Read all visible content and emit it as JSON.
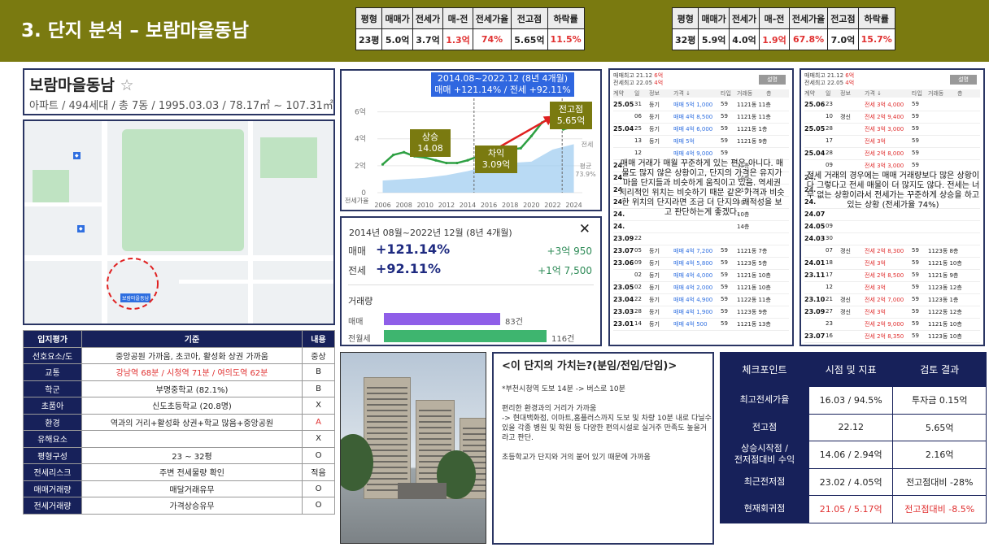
{
  "header": {
    "title": "3. 단지 분석 – 보람마을동남"
  },
  "stat_tables": [
    {
      "headers": [
        "평형",
        "매매가",
        "전세가",
        "매-전",
        "전세가율",
        "전고점",
        "하락률"
      ],
      "values": [
        "23평",
        "5.0억",
        "3.7억",
        "1.3억",
        "74%",
        "5.65억",
        "11.5%"
      ]
    },
    {
      "headers": [
        "평형",
        "매매가",
        "전세가",
        "매-전",
        "전세가율",
        "전고점",
        "하락률"
      ],
      "values": [
        "32평",
        "5.9억",
        "4.0억",
        "1.9억",
        "67.8%",
        "7.0억",
        "15.7%"
      ]
    }
  ],
  "complex": {
    "name": "보람마을동남",
    "star": "☆",
    "subtitle": "아파트 / 494세대 / 총 7동 / 1995.03.03 / 78.17㎡ ~ 107.31㎡"
  },
  "evaluation": {
    "headers": [
      "입지평가",
      "기준",
      "내용"
    ],
    "rows": [
      {
        "k": "선호요소/도",
        "c": "중앙공원 가까움, 초코아, 활성화 상권 가까움",
        "v": "중상",
        "hl": false
      },
      {
        "k": "교통",
        "c": "강남역 68분 / 시청역 71분 / 여의도역 62분",
        "v": "B",
        "hl": true
      },
      {
        "k": "학군",
        "c": "부명중학교 (82.1%)",
        "v": "B",
        "hl": false
      },
      {
        "k": "초품아",
        "c": "신도초등학교 (20.8명)",
        "v": "X",
        "hl": false
      },
      {
        "k": "환경",
        "c": "역과의 거리+활성화 상권+학교 많음+중앙공원",
        "v": "A",
        "hl": "v"
      },
      {
        "k": "유해요소",
        "c": "",
        "v": "X",
        "hl": false
      },
      {
        "k": "평형구성",
        "c": "23 ~ 32평",
        "v": "O",
        "hl": false
      },
      {
        "k": "전세리스크",
        "c": "주변 전세물량 확인",
        "v": "적음",
        "hl": false
      },
      {
        "k": "매매거래량",
        "c": "매달거래유무",
        "v": "O",
        "hl": false
      },
      {
        "k": "전세거래량",
        "c": "가격상승유무",
        "v": "O",
        "hl": false
      }
    ]
  },
  "chart_data": {
    "type": "line",
    "x_ticks": [
      "2006",
      "2008",
      "2010",
      "2012",
      "2014",
      "2016",
      "2018",
      "2020",
      "2022",
      "2024"
    ],
    "y_ticks": [
      "6억",
      "4억",
      "2억",
      "0"
    ],
    "ylim": [
      0,
      7
    ],
    "series": [
      {
        "name": "매매",
        "x": [
          2006,
          2007,
          2008,
          2009,
          2010,
          2011,
          2012,
          2013,
          2014,
          2015,
          2016,
          2017,
          2018,
          2019,
          2020,
          2021,
          2022,
          2023,
          2024
        ],
        "values": [
          2.1,
          2.8,
          3.0,
          2.7,
          2.6,
          2.4,
          2.2,
          2.2,
          2.4,
          2.7,
          2.9,
          3.0,
          3.2,
          3.3,
          4.2,
          5.2,
          5.65,
          4.7,
          4.9
        ]
      },
      {
        "name": "전세가",
        "x": [
          2006,
          2008,
          2010,
          2012,
          2014,
          2016,
          2018,
          2020,
          2022,
          2023,
          2024
        ],
        "values": [
          0.9,
          1.0,
          1.1,
          1.3,
          1.6,
          2.0,
          2.2,
          2.3,
          3.2,
          3.4,
          3.6
        ]
      }
    ],
    "labels": {
      "left_series": "전세가율",
      "right_value": "73.9%",
      "right_prefix": "평균",
      "right_mid": "전세"
    },
    "header": {
      "line1": "2014.08~2022.12 (8년 4개월)",
      "line2": "매매 +121.14%  /  전세 +92.11%"
    },
    "annotations": [
      {
        "text": "상승",
        "sub": "14.08"
      },
      {
        "text": "차익",
        "sub": "3.09억"
      },
      {
        "text": "전고점",
        "sub": "5.65억"
      }
    ]
  },
  "rate_card": {
    "title": "2014년 08월~2022년 12월 (8년 4개월)",
    "close": "✕",
    "rows": [
      {
        "label": "매매",
        "pct": "+121.14%",
        "amt": "+3억 950"
      },
      {
        "label": "전세",
        "pct": "+92.11%",
        "amt": "+1억 7,500"
      }
    ],
    "volume_title": "거래량",
    "volumes": [
      {
        "label": "매매",
        "count": 83,
        "text": "83건",
        "color": "#8f5ee8"
      },
      {
        "label": "전월세",
        "count": 116,
        "text": "116건",
        "color": "#3eb56f"
      }
    ]
  },
  "value_box": {
    "title": "<이 단지의 가치는?(분임/전임/단임)>",
    "paragraphs": [
      "*부천시청역 도보 14분 -> 버스로 10분",
      "편리한 환경과의 거리가 가까움\n-> 현대백화점, 이마트,홈플러스까지 도보 및 차량 10분 내로 다닐수 있을 각종 병원 및 학원 등 다양한 편의시설로 실거주 만족도 높을거라고 판단.",
      "초등학교가 단지와 거의 붙어 있기 때문에 가까움"
    ]
  },
  "trans_panels": [
    {
      "top1": "매매최고 21.12 ",
      "top1b": "6억",
      "top2": "전세최고 22.05 ",
      "top2b": "4억",
      "button": "설명",
      "cols": [
        "계약",
        "일",
        "정보",
        "가격 ↓",
        "타입",
        "거래동",
        "층"
      ],
      "rows": [
        [
          "25.05",
          "31",
          "등기",
          "매매 5억 1,000",
          "59",
          "1121동 11층",
          "b"
        ],
        [
          "",
          "06",
          "등기",
          "매매 4억 8,500",
          "59",
          "1121동 11층",
          "b"
        ],
        [
          "25.04",
          "25",
          "등기",
          "매매 4억 6,000",
          "59",
          "1121동 1층",
          "b"
        ],
        [
          "",
          "13",
          "등기",
          "매매 5억",
          "59",
          "1121동 9층",
          "b"
        ],
        [
          "",
          "12",
          "",
          "매매 4억 9,000",
          "59",
          "",
          "b"
        ],
        [
          "24.",
          "",
          "",
          "",
          "",
          "15층",
          "b"
        ],
        [
          "24.",
          "",
          "",
          "",
          "",
          "14층",
          "b"
        ],
        [
          "24.",
          "",
          "",
          "",
          "",
          "11층",
          "b"
        ],
        [
          "24.",
          "",
          "",
          "",
          "",
          "4층",
          "b"
        ],
        [
          "24.",
          "",
          "",
          "",
          "",
          "10층",
          "b"
        ],
        [
          "24.",
          "",
          "",
          "",
          "",
          "14층",
          "b"
        ],
        [
          "23.09",
          "22",
          "",
          "",
          "",
          "",
          "b"
        ],
        [
          "23.07",
          "05",
          "등기",
          "매매 4억 7,200",
          "59",
          "1121동 7층",
          "b"
        ],
        [
          "23.06",
          "09",
          "등기",
          "매매 4억 5,800",
          "59",
          "1123동 5층",
          "b"
        ],
        [
          "",
          "02",
          "등기",
          "매매 4억 4,000",
          "59",
          "1121동 10층",
          "b"
        ],
        [
          "23.05",
          "02",
          "등기",
          "매매 4억 2,000",
          "59",
          "1121동 10층",
          "b"
        ],
        [
          "23.04",
          "22",
          "등기",
          "매매 4억 4,900",
          "59",
          "1122동 11층",
          "b"
        ],
        [
          "23.03",
          "28",
          "등기",
          "매매 4억 1,900",
          "59",
          "1123동 9층",
          "b"
        ],
        [
          "23.01",
          "14",
          "등기",
          "매매 4억 500",
          "59",
          "1121동 13층",
          "b"
        ]
      ],
      "overlay": "매매 거래가 매월 꾸준하게 있는 편은 아니다. 매물도 많지 않은 상황이고, 단지의 가격은 유지가 마을 단지들과 비슷하게 움직이고 있음. 역세권 지리적인 위치는 비슷하기 때문 같은 가격과 비슷한 위치의 단지라면 조금 더 단지의 쾌적성을 보고 판단하는게 좋겠다."
    },
    {
      "top1": "매매최고 21.12 ",
      "top1b": "6억",
      "top2": "전세최고 22.05 ",
      "top2b": "4억",
      "button": "설명",
      "cols": [
        "계약",
        "일",
        "정보",
        "가격 ↓",
        "타입",
        "거래동",
        "층"
      ],
      "rows": [
        [
          "25.06",
          "23",
          "",
          "전세 3억 4,000",
          "59",
          "",
          "r"
        ],
        [
          "",
          "10",
          "갱신",
          "전세 2억 9,400",
          "59",
          "",
          "r"
        ],
        [
          "25.05",
          "28",
          "",
          "전세 3억 3,000",
          "59",
          "",
          "r"
        ],
        [
          "",
          "17",
          "",
          "전세 3억",
          "59",
          "",
          "r"
        ],
        [
          "25.04",
          "28",
          "",
          "전세 2억 8,000",
          "59",
          "",
          "r"
        ],
        [
          "",
          "09",
          "",
          "전세 3억 3,000",
          "59",
          "",
          "r"
        ],
        [
          "24.",
          "",
          "",
          "",
          "",
          "",
          "r"
        ],
        [
          "24.",
          "",
          "",
          "",
          "",
          "",
          "r"
        ],
        [
          "24.",
          "",
          "",
          "",
          "",
          "",
          "r"
        ],
        [
          "24.07",
          "",
          "",
          "",
          "",
          "",
          "r"
        ],
        [
          "24.05",
          "09",
          "",
          "",
          "",
          "",
          "r"
        ],
        [
          "24.03",
          "30",
          "",
          "",
          "",
          "",
          "r"
        ],
        [
          "",
          "07",
          "갱신",
          "전세 2억 8,300",
          "59",
          "1123동 8층",
          "r"
        ],
        [
          "24.01",
          "18",
          "",
          "전세 3억",
          "59",
          "1121동 10층",
          "r"
        ],
        [
          "23.11",
          "17",
          "",
          "전세 2억 8,500",
          "59",
          "1121동 9층",
          "r"
        ],
        [
          "",
          "12",
          "",
          "전세 3억",
          "59",
          "1123동 12층",
          "r"
        ],
        [
          "23.10",
          "21",
          "갱신",
          "전세 2억 7,000",
          "59",
          "1123동 1층",
          "r"
        ],
        [
          "23.09",
          "27",
          "갱신",
          "전세 3억",
          "59",
          "1122동 12층",
          "r"
        ],
        [
          "",
          "23",
          "",
          "전세 2억 9,000",
          "59",
          "1121동 10층",
          "r"
        ],
        [
          "23.07",
          "16",
          "",
          "전세 2억 8,350",
          "59",
          "1123동 10층",
          "r"
        ]
      ],
      "overlay": "전세 거래의 경우에는 매매 거래량보다 많은 상황이다 그렇다고 전세 매물이 더 많지도 않다. 전세는 너무 없는 상황이라서 전세가는 꾸준하게 상승을 하고 있는 상황 (전세가율 74%)"
    }
  ],
  "checkpoints": {
    "headers": [
      "체크포인트",
      "시점 및 지표",
      "검토 결과"
    ],
    "rows": [
      {
        "k": "최고전세가율",
        "a": "16.03 / 94.5%",
        "b": "투자금 0.15억",
        "red": false
      },
      {
        "k": "전고점",
        "a": "22.12",
        "b": "5.65억",
        "red": false
      },
      {
        "k": "상승시작점 /\n전저점대비 수익",
        "a": "14.06 / 2.94억",
        "b": "2.16억",
        "red": false
      },
      {
        "k": "최근전저점",
        "a": "23.02 / 4.05억",
        "b": "전고점대비 -28%",
        "red": false
      },
      {
        "k": "현재회귀점",
        "a": "21.05 / 5.17억",
        "b": "전고점대비 -8.5%",
        "red": true
      }
    ]
  },
  "map_labels": [
    "보람마을동남"
  ]
}
